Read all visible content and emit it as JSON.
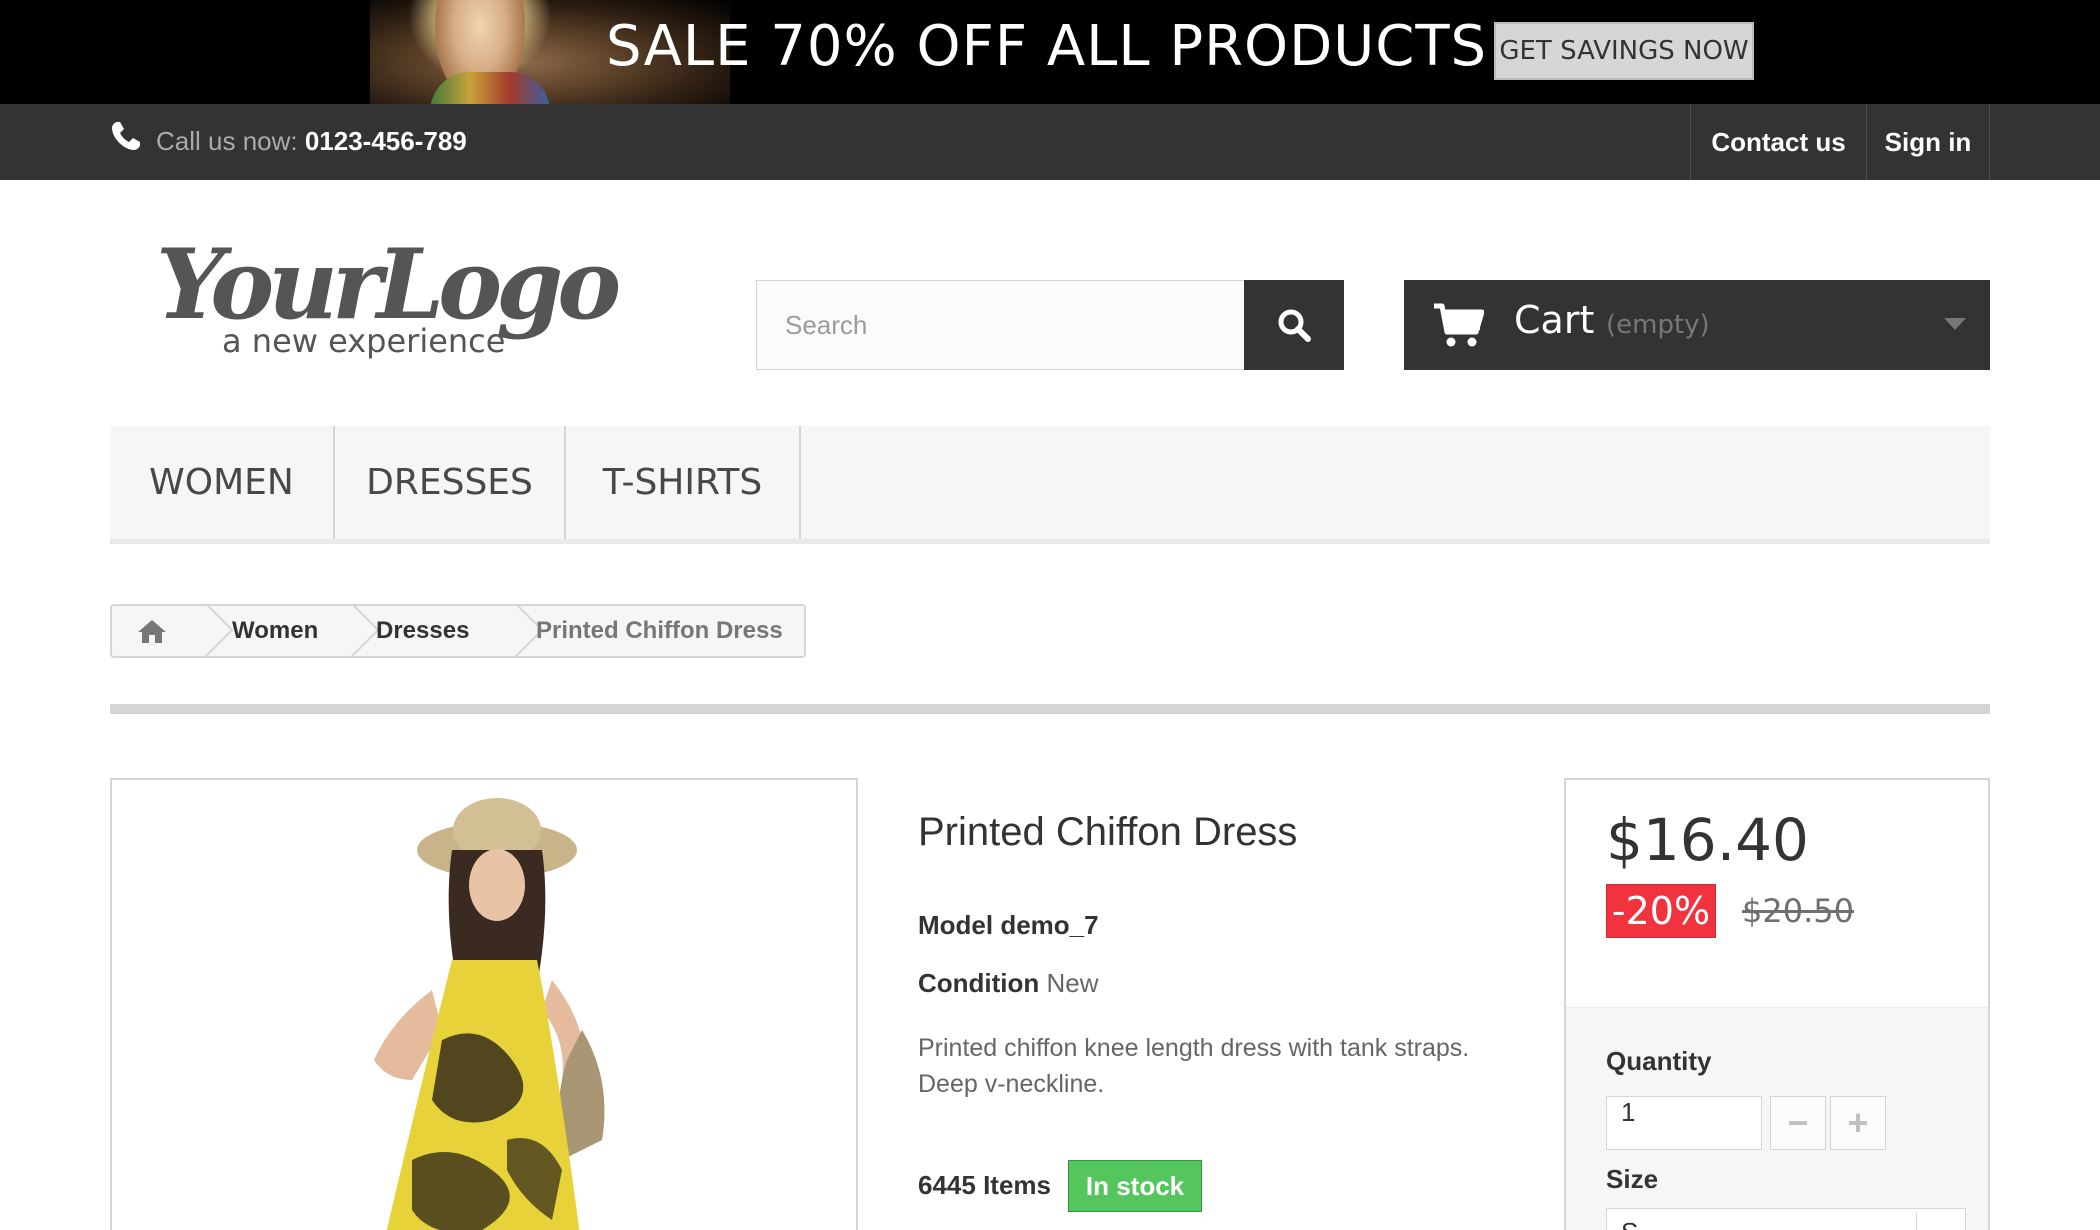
{
  "banner": {
    "text": "SALE 70% OFF ALL PRODUCTS",
    "button_label": "GET SAVINGS NOW"
  },
  "topnav": {
    "call_label": "Call us now: ",
    "phone": "0123-456-789",
    "contact_label": "Contact us",
    "signin_label": "Sign in"
  },
  "logo": {
    "line1": "YourLogo",
    "line2": "a new experience"
  },
  "search": {
    "placeholder": "Search"
  },
  "cart": {
    "label": "Cart",
    "status": "(empty)"
  },
  "menu": {
    "items": [
      {
        "label": "WOMEN"
      },
      {
        "label": "DRESSES"
      },
      {
        "label": "T-SHIRTS"
      }
    ]
  },
  "breadcrumb": {
    "women": "Women",
    "dresses": "Dresses",
    "current": "Printed Chiffon Dress"
  },
  "product": {
    "title": "Printed Chiffon Dress",
    "model": "Model demo_7",
    "condition_label": "Condition",
    "condition_value": "New",
    "description": "Printed chiffon knee length dress with tank straps. Deep v-neckline.",
    "quantity_text": "6445 Items",
    "stock_label": "In stock"
  },
  "pricing": {
    "price": "$16.40",
    "discount": "-20%",
    "old_price": "$20.50",
    "quantity_label": "Quantity",
    "quantity_value": "1",
    "minus": "−",
    "plus": "+",
    "size_label": "Size",
    "size_value": "S"
  },
  "colors": {
    "dark": "#333333",
    "sale_red": "#f13340",
    "stock_green": "#55c65e",
    "border": "#d6d4d4"
  }
}
